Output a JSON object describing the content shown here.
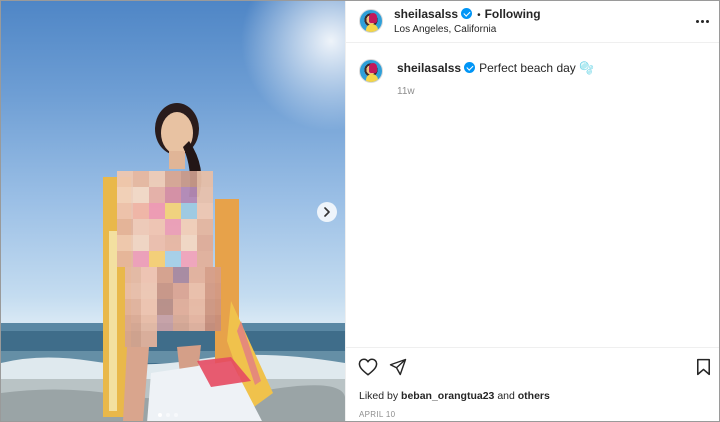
{
  "post": {
    "author": "sheilasalss",
    "separator": "•",
    "follow_status": "Following",
    "location": "Los Angeles, California",
    "caption_username": "sheilasalss",
    "caption_text": "Perfect beach day 🫧",
    "caption_time": "11w",
    "liked_by_prefix": "Liked by",
    "liked_by_user": "beban_orangtua23",
    "liked_by_and": "and",
    "liked_by_others": "others",
    "date": "APRIL 10"
  },
  "media": {
    "carousel_count": 3,
    "carousel_active": 0,
    "content": "beach photo (pixelated)"
  },
  "icons": {
    "more": "more-options-icon",
    "like": "heart-icon",
    "share": "share-icon",
    "save": "bookmark-icon",
    "verified": "verified-badge-icon",
    "next": "chevron-right-icon"
  }
}
